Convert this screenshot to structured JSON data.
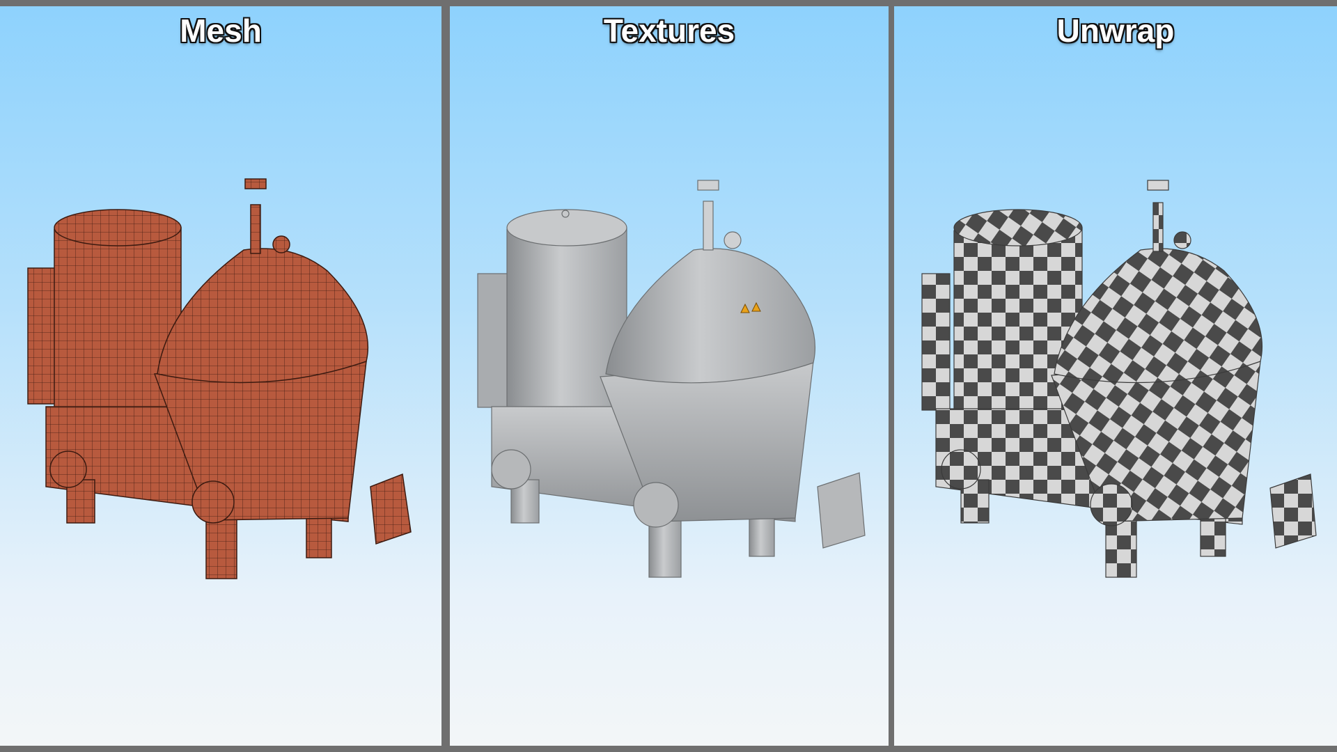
{
  "panels": [
    {
      "title": "Mesh",
      "style": "wireframe",
      "base_color": "#b85a3e",
      "line_color": "#3b1a10"
    },
    {
      "title": "Textures",
      "style": "textured",
      "base_color": "#b4b6b8",
      "line_color": "#6b6e70"
    },
    {
      "title": "Unwrap",
      "style": "checker",
      "base_color": "#d7d7d7",
      "line_color": "#4a4a4a"
    }
  ],
  "colors": {
    "sky_top": "#8ed2fd",
    "sky_bottom": "#f3f6f8",
    "divider": "#6f6f6f"
  }
}
